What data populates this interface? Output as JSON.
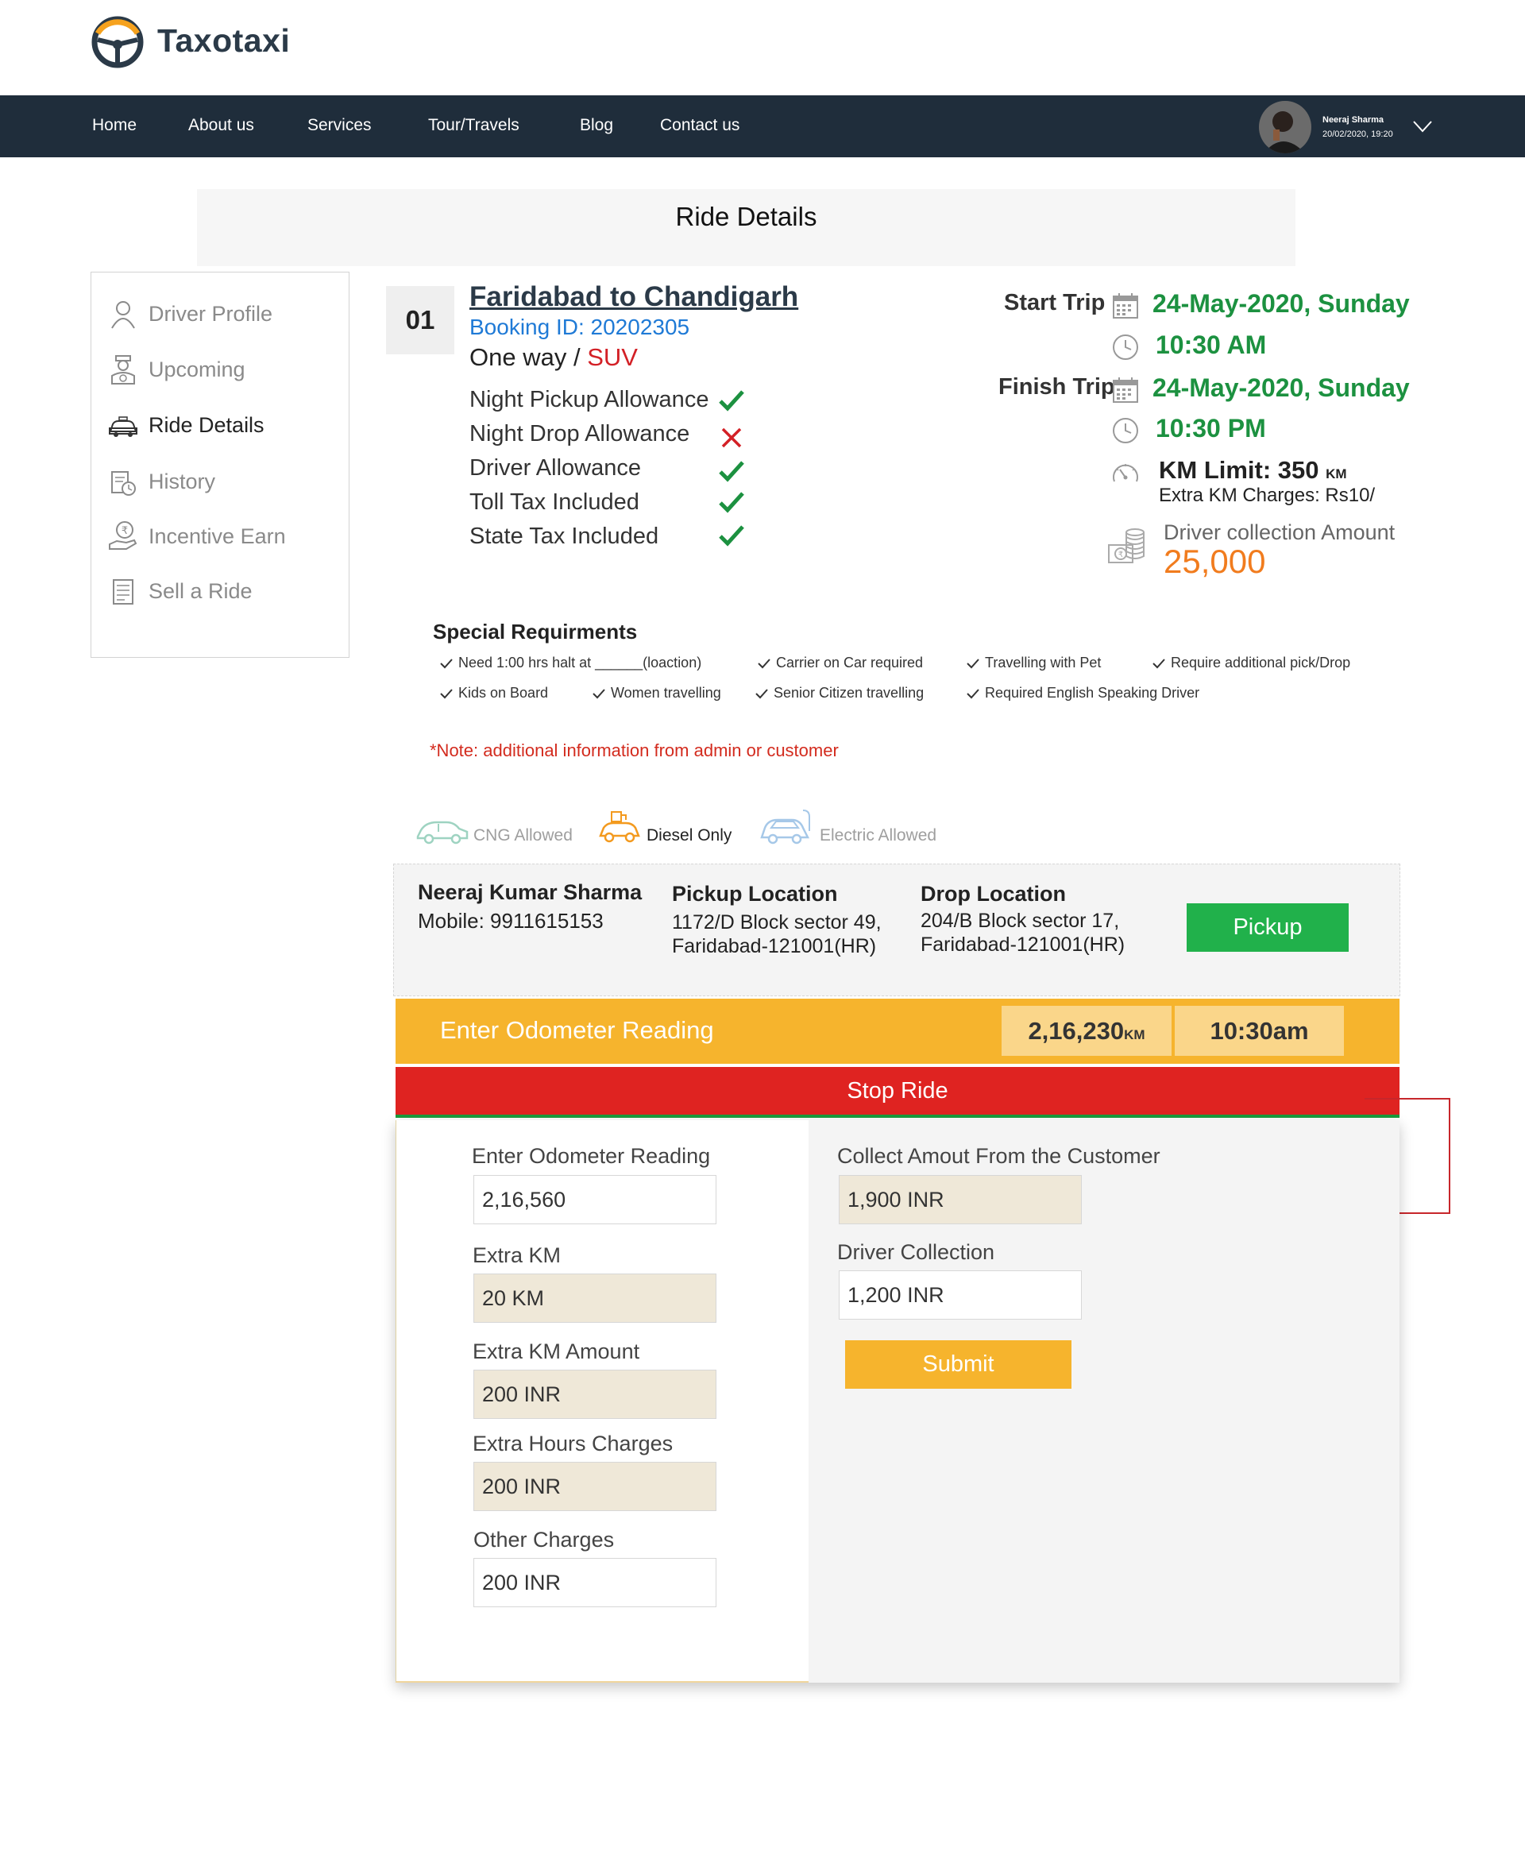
{
  "header": {
    "brand": "Taxotaxi",
    "nav": [
      "Home",
      "About us",
      "Services",
      "Tour/Travels",
      "Blog",
      "Contact us"
    ],
    "user": {
      "name": "Neeraj Sharma",
      "datetime": "20/02/2020,  19:20"
    }
  },
  "page_title": "Ride Details",
  "sidebar": {
    "items": [
      {
        "label": "Driver Profile",
        "icon": "user-icon"
      },
      {
        "label": "Upcoming",
        "icon": "chauffeur-icon"
      },
      {
        "label": "Ride Details",
        "icon": "taxi-icon",
        "active": true
      },
      {
        "label": "History",
        "icon": "history-icon"
      },
      {
        "label": "Incentive Earn",
        "icon": "rupee-hand-icon"
      },
      {
        "label": "Sell a Ride",
        "icon": "document-icon"
      }
    ]
  },
  "ride": {
    "number": "01",
    "route": "Faridabad to  Chandigarh",
    "booking_id": "Booking ID: 20202305",
    "trip_type": "One way / ",
    "vehicle": "SUV",
    "allowances": [
      {
        "label": "Night Pickup Allowance",
        "included": true
      },
      {
        "label": "Night Drop Allowance",
        "included": false
      },
      {
        "label": "Driver Allowance",
        "included": true
      },
      {
        "label": "Toll Tax Included",
        "included": true
      },
      {
        "label": "State Tax Included",
        "included": true
      }
    ],
    "start_label": "Start Trip",
    "start_date": "24-May-2020, Sunday",
    "start_time": "10:30 AM",
    "finish_label": "Finish Trip",
    "finish_date": "24-May-2020, Sunday",
    "finish_time": "10:30 PM",
    "km_limit": "KM Limit: 350",
    "km_unit": "KM",
    "extra_km_charges": "Extra KM Charges: Rs10/",
    "driver_collection_label": "Driver collection Amount",
    "driver_collection_amount": "25,000"
  },
  "special": {
    "title": "Special Requirments",
    "row1": [
      "Need 1:00 hrs halt at ______(loaction)",
      "Carrier on Car required",
      "Travelling with Pet",
      "Require additional pick/Drop"
    ],
    "row2": [
      "Kids on Board",
      "Women travelling",
      "Senior Citizen travelling",
      "Required English Speaking Driver"
    ],
    "note": "*Note: additional information from admin or customer"
  },
  "fuel": {
    "cng": "CNG Allowed",
    "diesel": "Diesel Only",
    "electric": "Electric Allowed",
    "colors": {
      "cng": "#9ed3c1",
      "diesel": "#f39a1f",
      "electric": "#a6c8e8"
    }
  },
  "passenger": {
    "name": "Neeraj Kumar Sharma",
    "mobile": "Mobile: 9911615153",
    "pickup_heading": "Pickup Location",
    "pickup_line1": "1172/D Block sector 49,",
    "pickup_line2": "Faridabad-121001(HR)",
    "drop_heading": "Drop Location",
    "drop_line1": "204/B Block sector 17,",
    "drop_line2": "Faridabad-121001(HR)",
    "pickup_button": "Pickup"
  },
  "odometer": {
    "label": "Enter Odometer Reading",
    "reading": "2,16,230",
    "unit": "KM",
    "time": "10:30am"
  },
  "stop_ride": "Stop Ride",
  "form": {
    "odometer_label": "Enter Odometer Reading",
    "odometer_value": "2,16,560",
    "extra_km_label": "Extra KM",
    "extra_km_value": "20 KM",
    "extra_km_amount_label": "Extra KM Amount",
    "extra_km_amount_value": "200 INR",
    "extra_hours_label": "Extra Hours Charges",
    "extra_hours_value": "200 INR",
    "other_charges_label": "Other Charges",
    "other_charges_value": "200 INR",
    "collect_label": "Collect Amout From the Customer",
    "collect_value": "1,900 INR",
    "driver_collection_label": "Driver Collection",
    "driver_collection_value": "1,200 INR",
    "submit": "Submit"
  },
  "colors": {
    "navbar": "#1f2d3b",
    "accent_orange": "#f6b42d",
    "stop_red": "#df2321",
    "pickup_green": "#21b14b",
    "date_green": "#1c9140",
    "amount_orange": "#f17c1e",
    "link_blue": "#1f7ad6"
  }
}
